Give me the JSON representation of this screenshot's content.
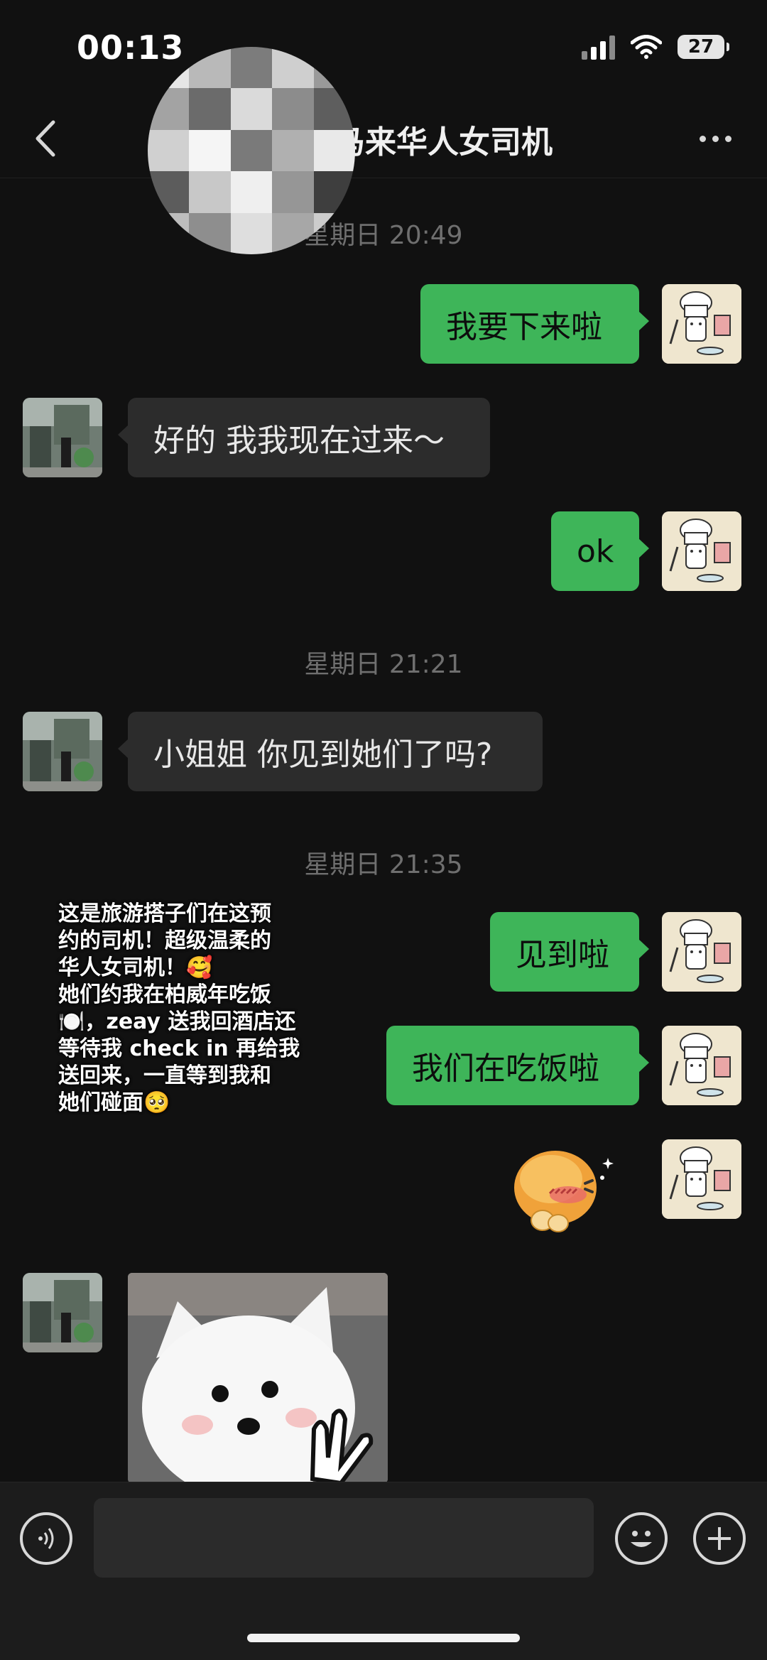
{
  "status_bar": {
    "time": "00:13",
    "battery": "27",
    "signal_icon": "cellular-signal-icon",
    "wifi_icon": "wifi-icon"
  },
  "nav": {
    "title": "马来华人女司机",
    "back_icon": "chevron-left-icon",
    "more_icon": "more-dots-icon"
  },
  "messages": {
    "ts1": "星期日 20:49",
    "m1": "我要下来啦",
    "m2": "好的 我我现在过来～",
    "m3": "ok",
    "ts2": "星期日 21:21",
    "m4": "小姐姐 你见到她们了吗?",
    "ts3": "星期日 21:35",
    "m5": "见到啦",
    "m6": "我们在吃饭啦"
  },
  "overlay_note": {
    "line1": "这是旅游搭子们在这预",
    "line2": "约的司机！超级温柔的",
    "line3": "华人女司机！🥰",
    "line4": "她们约我在柏威年吃饭",
    "line5": "🍽️，zeay 送我回酒店还",
    "line6": "等待我 check in 再给我",
    "line7": "送回来，一直等到我和",
    "line8": "她们碰面🥺"
  },
  "input_bar": {
    "placeholder": "",
    "voice_icon": "voice-icon",
    "emoji_icon": "emoji-icon",
    "plus_icon": "plus-icon"
  },
  "colors": {
    "background": "#111111",
    "bubble_out": "#3eb559",
    "bubble_in": "#2c2c2c",
    "timestamp": "#6f6f6f"
  }
}
